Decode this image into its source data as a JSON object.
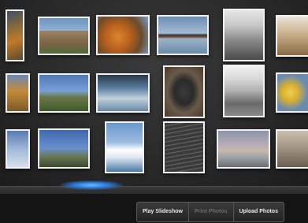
{
  "toolbar": {
    "play_slideshow": "Play Slideshow",
    "print_photos": "Print Photos",
    "upload_photos": "Upload Photos"
  },
  "colors": {
    "accent_blue": "#2a78d8",
    "frame": "#f2f2f2",
    "background": "#2a2a2a"
  }
}
